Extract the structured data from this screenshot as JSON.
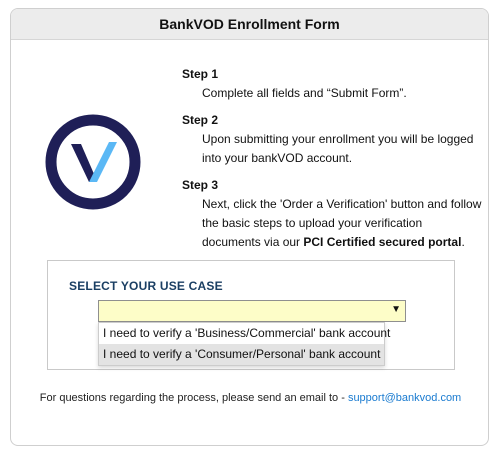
{
  "form": {
    "title": "BankVOD Enrollment Form"
  },
  "logo": {
    "icon": "bankvod-v-logo-icon",
    "ring_color": "#1f1f57",
    "check_color": "#5bb8f5"
  },
  "steps": [
    {
      "title": "Step 1",
      "text": "Complete all fields and “Submit Form”."
    },
    {
      "title": "Step 2",
      "text": "Upon submitting your enrollment you will be logged into your bankVOD account."
    },
    {
      "title": "Step 3",
      "text_part1": "Next, click the 'Order a Verification' button and follow the basic steps to upload your verification documents via our ",
      "text_bold": "PCI Certified secured portal",
      "text_part2": "."
    }
  ],
  "use_case": {
    "label": "SELECT YOUR USE CASE",
    "selected_value": "",
    "arrow_icon": "▼",
    "options": [
      "I need to verify a 'Business/Commercial' bank account",
      "I need to verify a 'Consumer/Personal' bank account"
    ]
  },
  "footer": {
    "text": "For questions regarding the process, please send an email to - ",
    "email": "support@bankvod.com"
  }
}
